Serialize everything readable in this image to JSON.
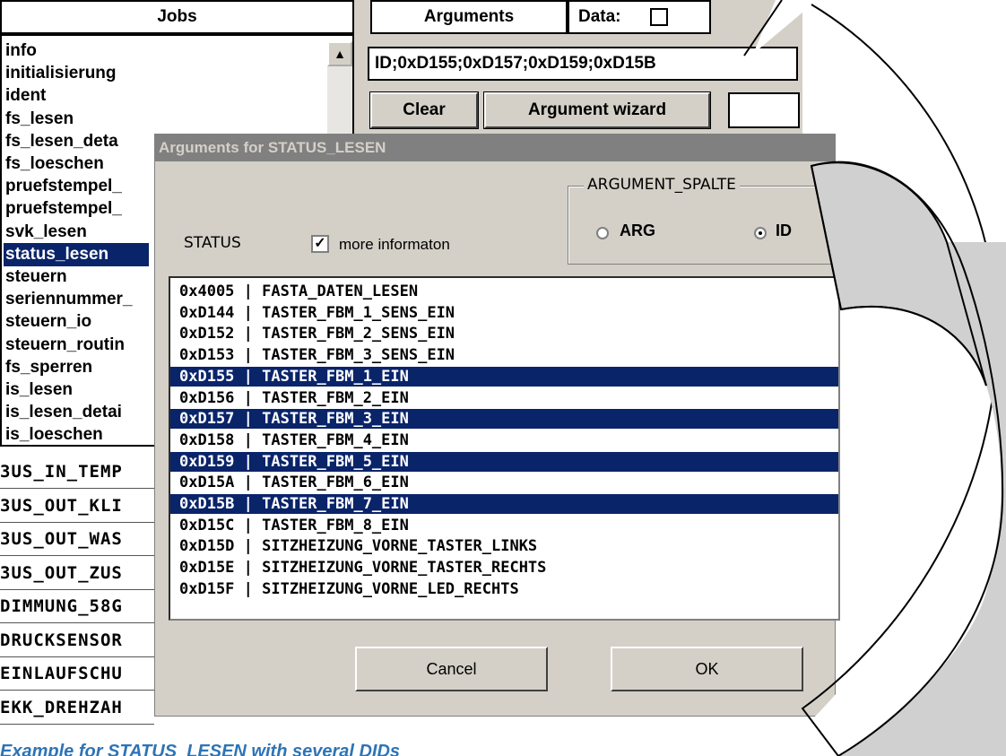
{
  "jobs": {
    "header": "Jobs",
    "items": [
      "info",
      "initialisierung",
      "ident",
      "fs_lesen",
      "fs_lesen_deta",
      "fs_loeschen",
      "pruefstempel_",
      "pruefstempel_",
      "svk_lesen",
      "status_lesen",
      "steuern",
      "seriennummer_",
      "steuern_io",
      "steuern_routin",
      "fs_sperren",
      "is_lesen",
      "is_lesen_detai",
      "is_loeschen"
    ],
    "selected": "status_lesen",
    "scroll_up_icon": "arrow-up-icon"
  },
  "results": [
    "3US_IN_TEMP",
    "3US_OUT_KLI",
    "3US_OUT_WAS",
    "3US_OUT_ZUS",
    "DIMMUNG_58G",
    "DRUCKSENSOR",
    "EINLAUFSCHU",
    "EKK_DREHZAH"
  ],
  "arguments": {
    "title": "Arguments",
    "data_label": "Data:",
    "value": "ID;0xD155;0xD157;0xD159;0xD15B",
    "clear_label": "Clear",
    "wizard_label": "Argument wizard"
  },
  "dialog": {
    "title": "Arguments for STATUS_LESEN",
    "group_label": "ARGUMENT_SPALTE",
    "radio_arg": "ARG",
    "radio_id": "ID",
    "selected_radio": "ID",
    "status_label": "STATUS",
    "more_info_label": "more informaton",
    "more_info_checked": true,
    "list": [
      {
        "text": "0x4005 | FASTA_DATEN_LESEN",
        "selected": false
      },
      {
        "text": "0xD144 | TASTER_FBM_1_SENS_EIN",
        "selected": false
      },
      {
        "text": "0xD152 | TASTER_FBM_2_SENS_EIN",
        "selected": false
      },
      {
        "text": "0xD153 | TASTER_FBM_3_SENS_EIN",
        "selected": false
      },
      {
        "text": "0xD155 | TASTER_FBM_1_EIN",
        "selected": true
      },
      {
        "text": "0xD156 | TASTER_FBM_2_EIN",
        "selected": false
      },
      {
        "text": "0xD157 | TASTER_FBM_3_EIN",
        "selected": true
      },
      {
        "text": "0xD158 | TASTER_FBM_4_EIN",
        "selected": false
      },
      {
        "text": "0xD159 | TASTER_FBM_5_EIN",
        "selected": true
      },
      {
        "text": "0xD15A | TASTER_FBM_6_EIN",
        "selected": false
      },
      {
        "text": "0xD15B | TASTER_FBM_7_EIN",
        "selected": true
      },
      {
        "text": "0xD15C | TASTER_FBM_8_EIN",
        "selected": false
      },
      {
        "text": "0xD15D | SITZHEIZUNG_VORNE_TASTER_LINKS",
        "selected": false
      },
      {
        "text": "0xD15E | SITZHEIZUNG_VORNE_TASTER_RECHTS",
        "selected": false
      },
      {
        "text": "0xD15F | SITZHEIZUNG_VORNE_LED_RECHTS",
        "selected": false
      }
    ],
    "cancel_label": "Cancel",
    "ok_label": "OK"
  },
  "caption": "Example for STATUS_LESEN with several DIDs",
  "colors": {
    "selection": "#0a246a",
    "window_gray": "#d4d0c8",
    "caption_blue": "#2e74b5",
    "arrow_fill": "#d0d0d0"
  }
}
